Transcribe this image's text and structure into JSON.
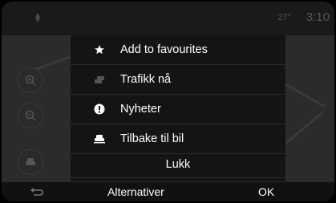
{
  "status": {
    "temperature": "27°",
    "time": "3:10"
  },
  "menu": {
    "items": [
      {
        "label": "Add to favourites",
        "icon": "star-icon"
      },
      {
        "label": "Trafikk nå",
        "icon": "traffic-car-icon"
      },
      {
        "label": "Nyheter",
        "icon": "info-icon"
      },
      {
        "label": "Tilbake til bil",
        "icon": "car-icon"
      }
    ],
    "close_label": "Lukk"
  },
  "bottom": {
    "options_label": "Alternativer",
    "ok_label": "OK",
    "back_icon": "back-arrow-icon"
  },
  "side_buttons": [
    "zoom-in-icon",
    "zoom-out-icon",
    "car-icon"
  ],
  "colors": {
    "background": "#1f1f1f",
    "menu_bg": "#141414",
    "text": "#ffffff"
  }
}
